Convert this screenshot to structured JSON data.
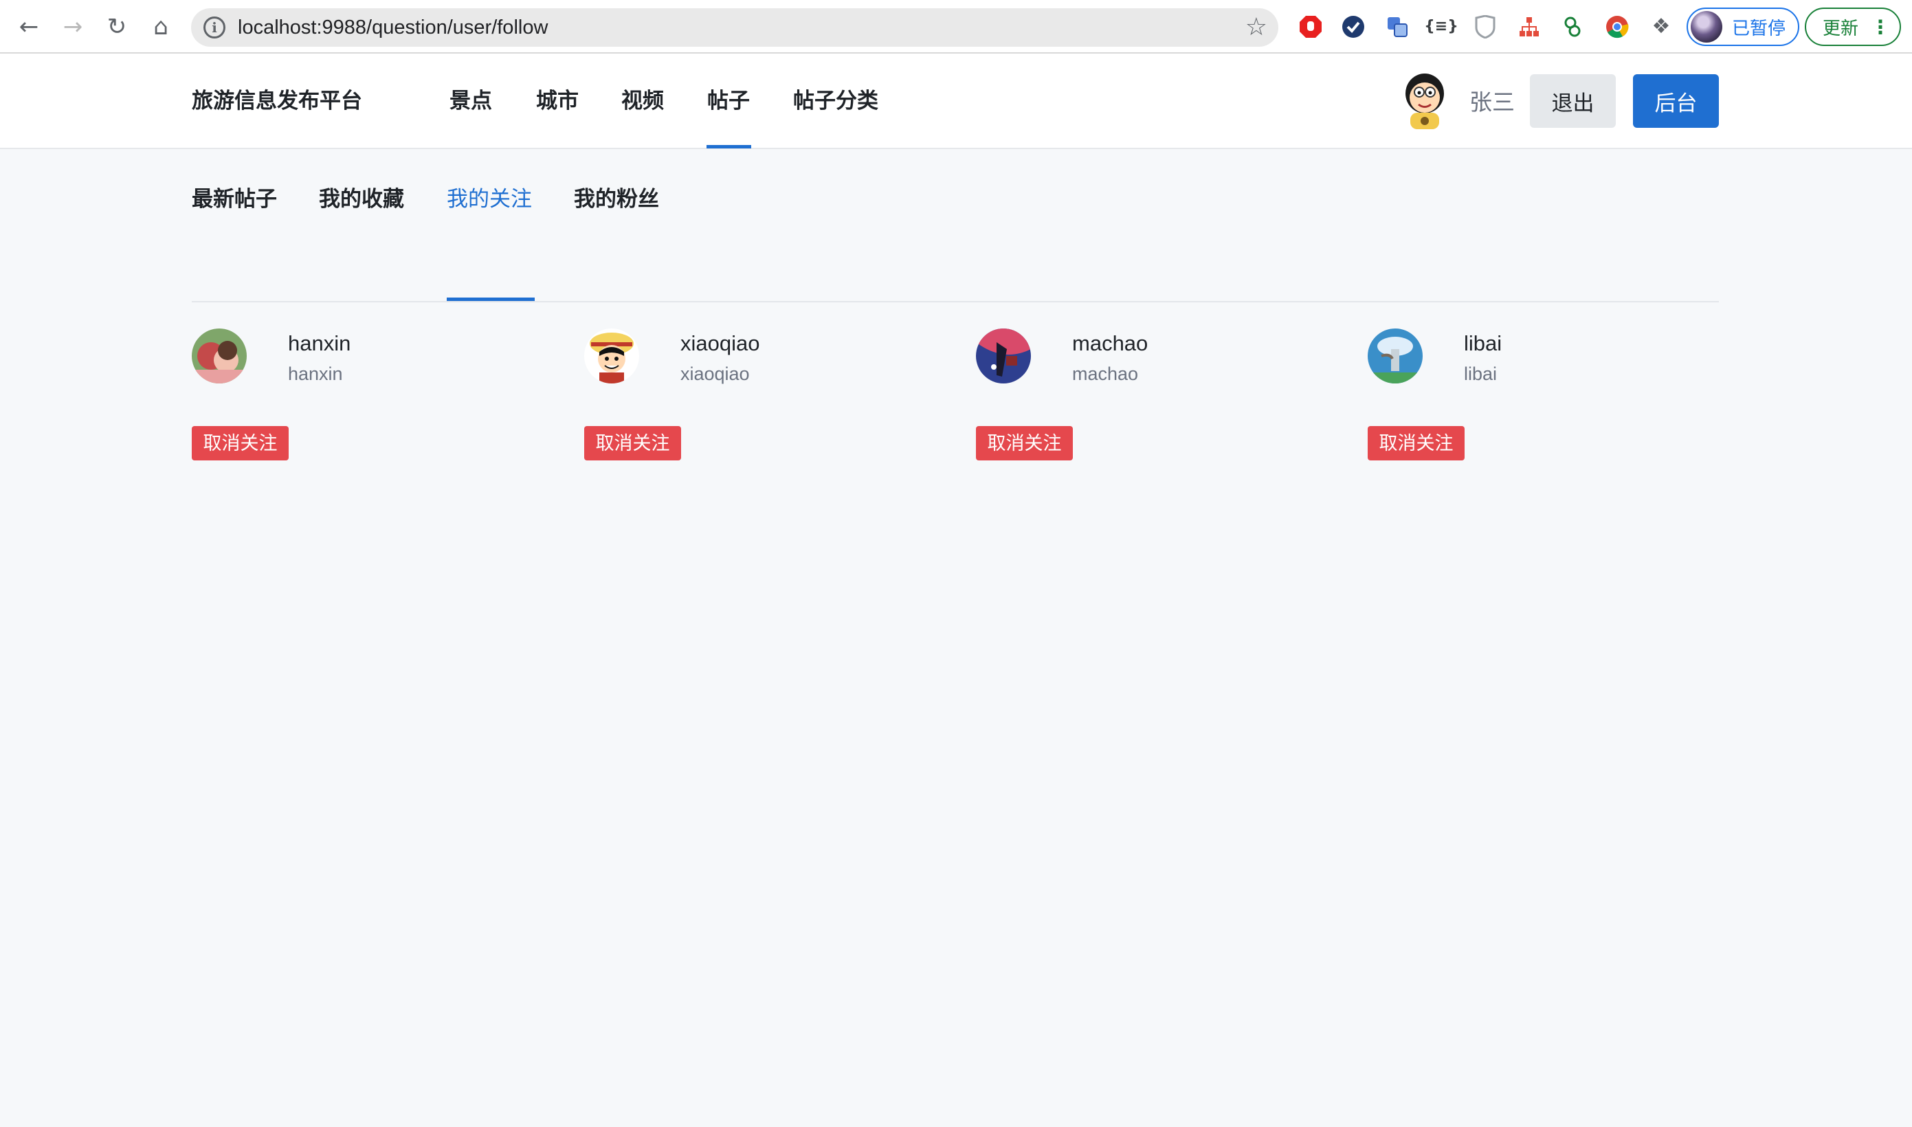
{
  "browser": {
    "url": "localhost:9988/question/user/follow",
    "profile_label": "已暂停",
    "update_label": "更新",
    "extensions": [
      "ublock-icon",
      "check-icon",
      "translate-icon",
      "json-icon",
      "shield-icon",
      "sitemap-icon",
      "puzzle-ext-icon",
      "chrome-icon",
      "extensions-icon"
    ]
  },
  "header": {
    "brand": "旅游信息发布平台",
    "nav": [
      "景点",
      "城市",
      "视频",
      "帖子",
      "帖子分类"
    ],
    "active_nav": "帖子",
    "user_name": "张三",
    "logout_label": "退出",
    "admin_label": "后台"
  },
  "sub_tabs": {
    "items": [
      "最新帖子",
      "我的收藏",
      "我的关注",
      "我的粉丝"
    ],
    "active": "我的关注"
  },
  "follows": [
    {
      "name": "hanxin",
      "handle": "hanxin",
      "button": "取消关注",
      "avatar_color": "#c85a5a"
    },
    {
      "name": "xiaoqiao",
      "handle": "xiaoqiao",
      "button": "取消关注",
      "avatar_color": "#f4d35e"
    },
    {
      "name": "machao",
      "handle": "machao",
      "button": "取消关注",
      "avatar_color": "#2e3f8f"
    },
    {
      "name": "libai",
      "handle": "libai",
      "button": "取消关注",
      "avatar_color": "#3a8fc9"
    }
  ],
  "colors": {
    "primary": "#1f6fd1",
    "danger": "#e5484d",
    "page_bg": "#f6f8fa"
  }
}
